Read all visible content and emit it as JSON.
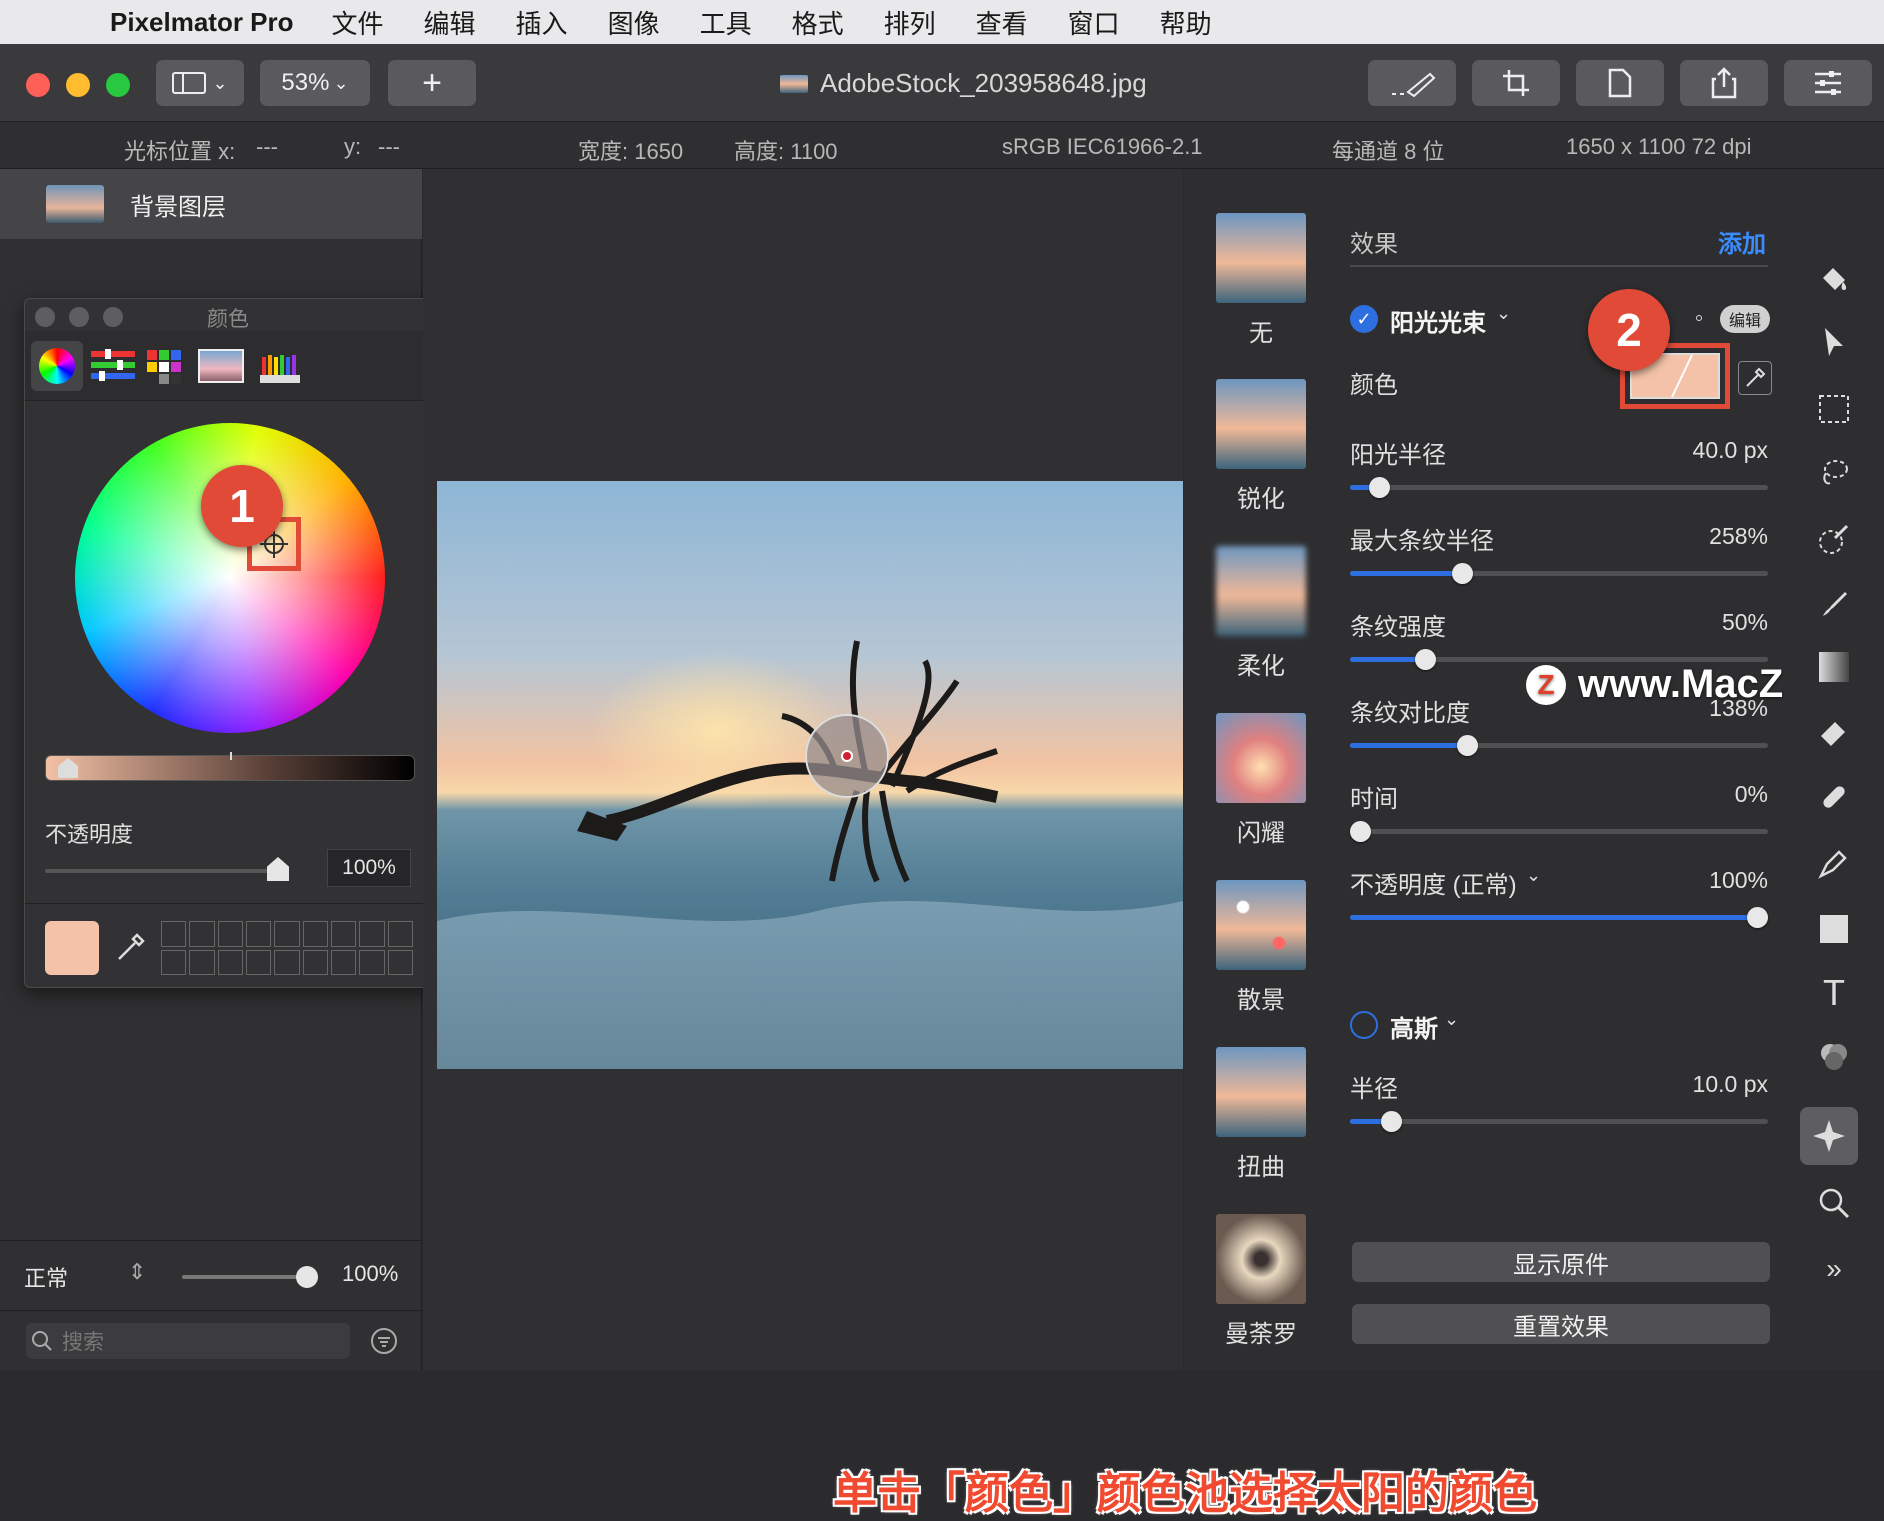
{
  "menu": {
    "app_name": "Pixelmator Pro",
    "items": [
      "文件",
      "编辑",
      "插入",
      "图像",
      "工具",
      "格式",
      "排列",
      "查看",
      "窗口",
      "帮助"
    ]
  },
  "toolbar": {
    "zoom": "53%",
    "doc_title": "AdobeStock_203958648.jpg"
  },
  "infobar": {
    "cursor_x_label": "光标位置 x:",
    "cursor_x_value": "---",
    "cursor_y_label": "y:",
    "cursor_y_value": "---",
    "width": "宽度: 1650",
    "height": "高度: 1100",
    "color_profile": "sRGB IEC61966-2.1",
    "bit_depth": "每通道 8 位",
    "dims": "1650 x 1100 72 dpi"
  },
  "layers": {
    "items": [
      {
        "label": "背景图层"
      }
    ]
  },
  "color_panel": {
    "title": "颜色",
    "opacity_label": "不透明度",
    "opacity_value": "100%",
    "current_color": "#f4c2a8"
  },
  "left_bottom": {
    "blend_mode": "正常",
    "opacity": "100%",
    "search_placeholder": "搜索"
  },
  "effects": {
    "thumbs": [
      "无",
      "锐化",
      "柔化",
      "闪耀",
      "散景",
      "扭曲",
      "曼荼罗"
    ],
    "header": "效果",
    "add": "添加",
    "sunbeam": {
      "name": "阳光光束",
      "edit": "编辑",
      "color_label": "颜色",
      "color": "#f4c2a8",
      "sun_radius_label": "阳光半径",
      "sun_radius_value": "40.0 px",
      "sun_radius_frac": 0.07,
      "max_streak_label": "最大条纹半径",
      "max_streak_value": "258%",
      "max_streak_frac": 0.27,
      "streak_strength_label": "条纹强度",
      "streak_strength_value": "50%",
      "streak_strength_frac": 0.18,
      "streak_contrast_label": "条纹对比度",
      "streak_contrast_value": "138%",
      "streak_contrast_frac": 0.28,
      "time_label": "时间",
      "time_value": "0%",
      "time_frac": 0.0,
      "opacity_label": "不透明度 (正常)",
      "opacity_value": "100%",
      "opacity_frac": 1.0
    },
    "gaussian": {
      "name": "高斯",
      "radius_label": "半径",
      "radius_value": "10.0 px",
      "radius_frac": 0.1
    },
    "show_original": "显示原件",
    "reset": "重置效果"
  },
  "annotations": {
    "badge1": "1",
    "badge2": "2",
    "caption": "单击「颜色」颜色池选择太阳的颜色",
    "watermark": "www.MacZ.com",
    "watermark_logo": "Z"
  },
  "accent": "#2d6fe0",
  "annotation_red": "#e24a38"
}
